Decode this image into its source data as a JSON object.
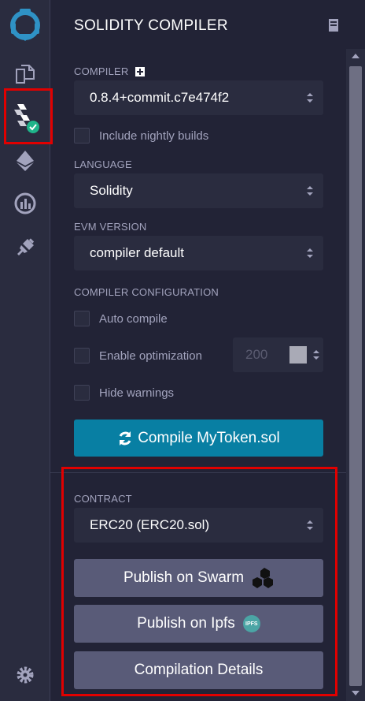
{
  "header": {
    "title": "SOLIDITY COMPILER"
  },
  "compiler": {
    "label": "COMPILER",
    "version": "0.8.4+commit.c7e474f2",
    "nightly_label": "Include nightly builds"
  },
  "language": {
    "label": "LANGUAGE",
    "value": "Solidity"
  },
  "evm": {
    "label": "EVM VERSION",
    "value": "compiler default"
  },
  "config": {
    "label": "COMPILER CONFIGURATION",
    "auto_compile": "Auto compile",
    "optimization": "Enable optimization",
    "runs": "200",
    "hide_warnings": "Hide warnings"
  },
  "compile_button": "Compile MyToken.sol",
  "contract": {
    "label": "CONTRACT",
    "value": "ERC20 (ERC20.sol)"
  },
  "buttons": {
    "swarm": "Publish on Swarm",
    "ipfs": "Publish on Ipfs",
    "ipfs_badge": "IPFS",
    "details": "Compilation Details"
  },
  "colors": {
    "background": "#222336",
    "rail": "#2a2c3f",
    "accent": "#087fa3",
    "highlight": "#e10000",
    "success": "#1fb48a"
  }
}
